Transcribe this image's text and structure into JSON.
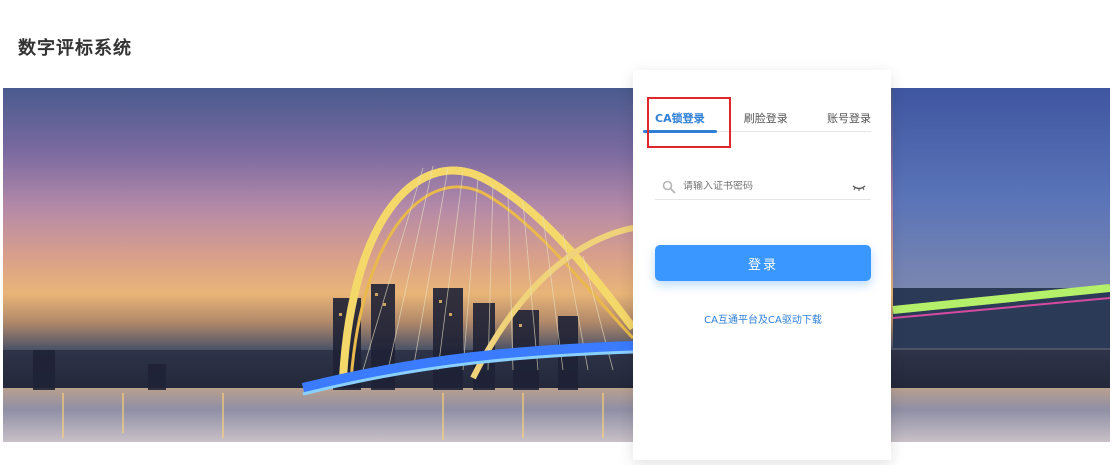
{
  "app": {
    "title": "数字评标系统"
  },
  "login": {
    "tabs": [
      {
        "label": "CA锁登录",
        "active": true
      },
      {
        "label": "刷脸登录",
        "active": false
      },
      {
        "label": "账号登录",
        "active": false
      }
    ],
    "password_placeholder": "请输入证书密码",
    "submit_label": "登录",
    "download_link": "CA互通平台及CA驱动下载"
  },
  "colors": {
    "accent": "#3a97ff",
    "tab_active": "#2f7fd6",
    "highlight": "#e0262b",
    "title": "#333333"
  },
  "icons": {
    "input_leading": "search-icon",
    "input_trailing": "eye-icon"
  }
}
